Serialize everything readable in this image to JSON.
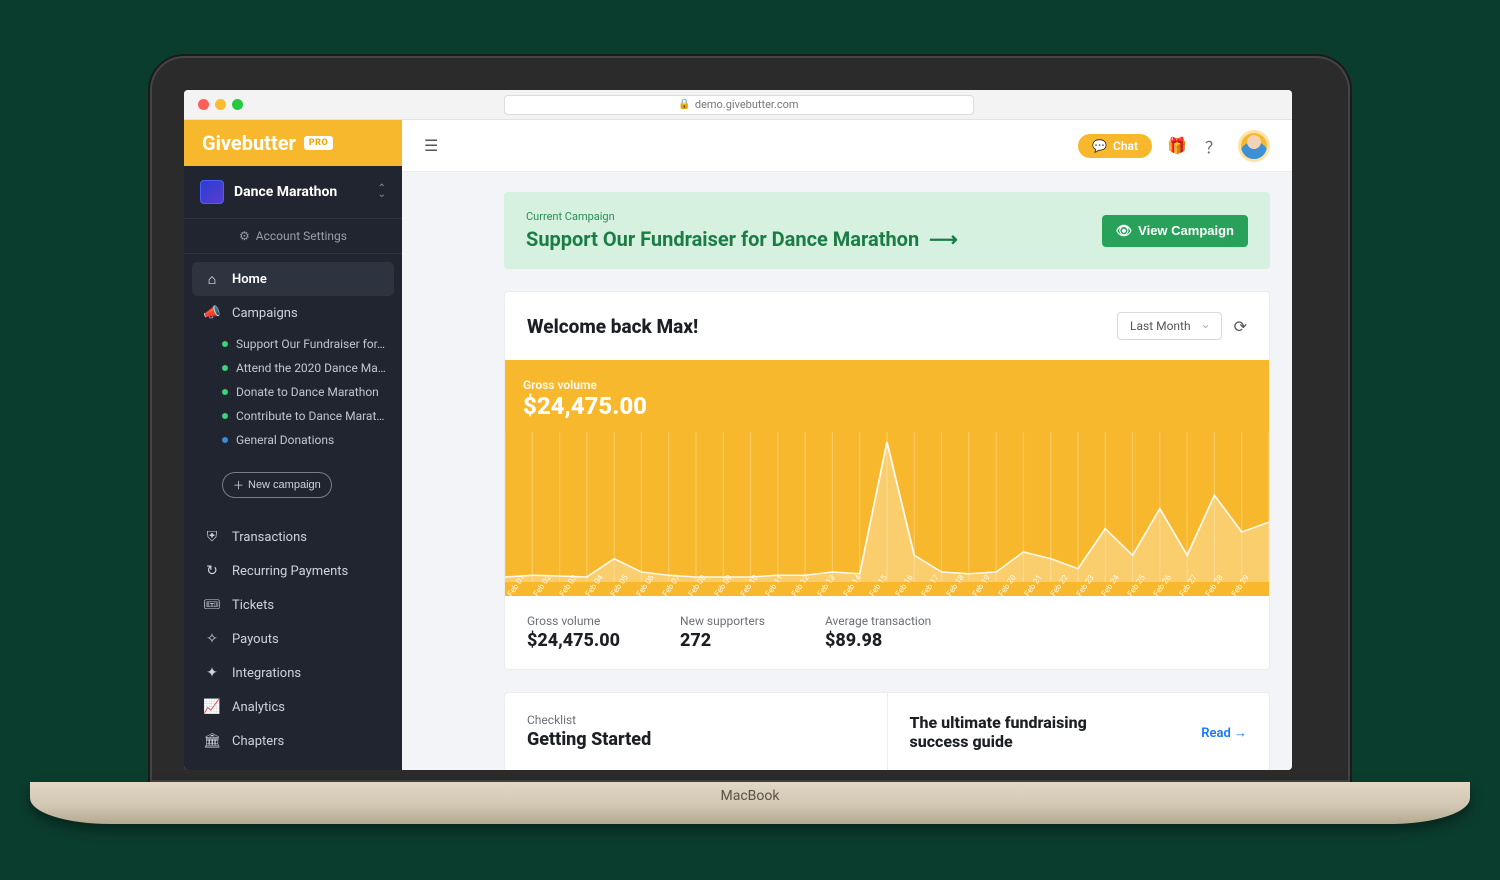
{
  "browser": {
    "url": "demo.givebutter.com"
  },
  "brand": {
    "name": "Givebutter",
    "badge": "PRO"
  },
  "account": {
    "name": "Dance Marathon",
    "settings_label": "Account Settings"
  },
  "nav": {
    "home": "Home",
    "campaigns": "Campaigns",
    "campaign_items": [
      {
        "label": "Support Our Fundraiser for…",
        "color": "green"
      },
      {
        "label": "Attend the 2020 Dance Mar…",
        "color": "green"
      },
      {
        "label": "Donate to Dance Marathon",
        "color": "green"
      },
      {
        "label": "Contribute to Dance Marat…",
        "color": "green"
      },
      {
        "label": "General Donations",
        "color": "blue"
      }
    ],
    "new_campaign": "New campaign",
    "transactions": "Transactions",
    "recurring": "Recurring Payments",
    "tickets": "Tickets",
    "payouts": "Payouts",
    "integrations": "Integrations",
    "analytics": "Analytics",
    "chapters": "Chapters"
  },
  "topbar": {
    "chat": "Chat"
  },
  "banner": {
    "label": "Current Campaign",
    "title": "Support Our Fundraiser for Dance Marathon",
    "view": "View Campaign"
  },
  "dashboard": {
    "welcome": "Welcome back Max!",
    "range": "Last Month",
    "gross_label": "Gross volume",
    "gross_value": "$24,475.00",
    "stats": [
      {
        "label": "Gross volume",
        "value": "$24,475.00"
      },
      {
        "label": "New supporters",
        "value": "272"
      },
      {
        "label": "Average transaction",
        "value": "$89.98"
      }
    ]
  },
  "bottom": {
    "checklist_label": "Checklist",
    "checklist_title": "Getting Started",
    "guide_title": "The ultimate fundraising success guide",
    "read": "Read"
  },
  "chart_data": {
    "type": "area",
    "title": "Gross volume",
    "ylabel": "Gross volume",
    "xlabel": "",
    "ylim": [
      0,
      4500
    ],
    "categories": [
      "Feb 01",
      "Feb 02",
      "Feb 03",
      "Feb 04",
      "Feb 05",
      "Feb 06",
      "Feb 07",
      "Feb 08",
      "Feb 09",
      "Feb 10",
      "Feb 11",
      "Feb 12",
      "Feb 13",
      "Feb 14",
      "Feb 15",
      "Feb 16",
      "Feb 17",
      "Feb 18",
      "Feb 19",
      "Feb 20",
      "Feb 21",
      "Feb 22",
      "Feb 23",
      "Feb 24",
      "Feb 25",
      "Feb 26",
      "Feb 27",
      "Feb 28",
      "Feb 29"
    ],
    "values": [
      150,
      200,
      180,
      150,
      700,
      300,
      200,
      150,
      150,
      150,
      200,
      200,
      300,
      250,
      4200,
      800,
      300,
      250,
      300,
      900,
      700,
      400,
      1600,
      800,
      2200,
      800,
      2600,
      1500,
      1800
    ]
  }
}
